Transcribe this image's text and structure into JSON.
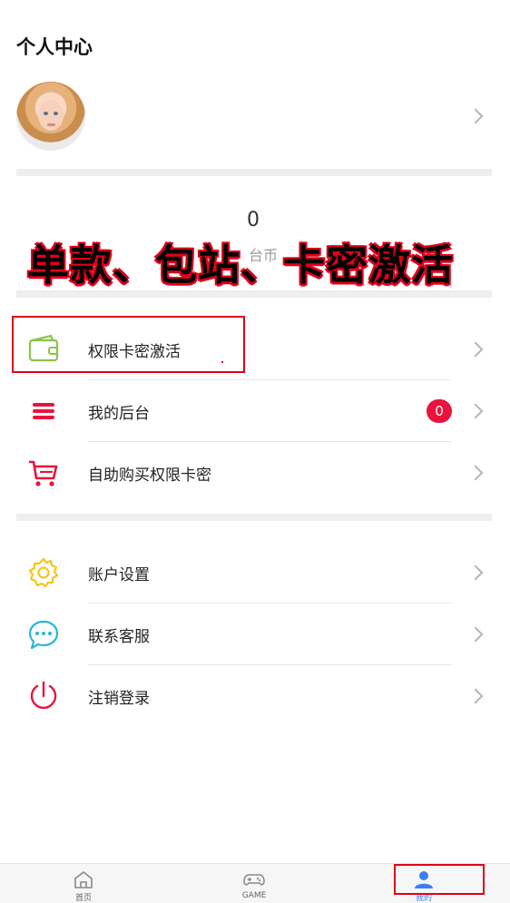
{
  "header": {
    "title": "个人中心"
  },
  "balance": {
    "value": "0",
    "unit": "台币"
  },
  "overlay_text": "单款、包站、卡密激活",
  "menu_primary": [
    {
      "label": "权限卡密激活",
      "icon": "wallet-icon"
    },
    {
      "label": "我的后台",
      "icon": "list-icon",
      "badge": "0"
    },
    {
      "label": "自助购买权限卡密",
      "icon": "cart-icon"
    }
  ],
  "menu_secondary": [
    {
      "label": "账户设置",
      "icon": "gear-icon"
    },
    {
      "label": "联系客服",
      "icon": "chat-bubble-icon"
    },
    {
      "label": "注销登录",
      "icon": "power-icon"
    }
  ],
  "tabbar": [
    {
      "label": "首页",
      "icon": "home-icon"
    },
    {
      "label": "GAME",
      "icon": "gamepad-icon"
    },
    {
      "label": "我的",
      "icon": "user-icon",
      "active": true
    }
  ],
  "colors": {
    "accent_red": "#e8143c",
    "tab_active": "#3b7ff5",
    "wallet_green": "#8bc34a",
    "gear_yellow": "#f5c518",
    "chat_blue": "#29b6d8"
  }
}
